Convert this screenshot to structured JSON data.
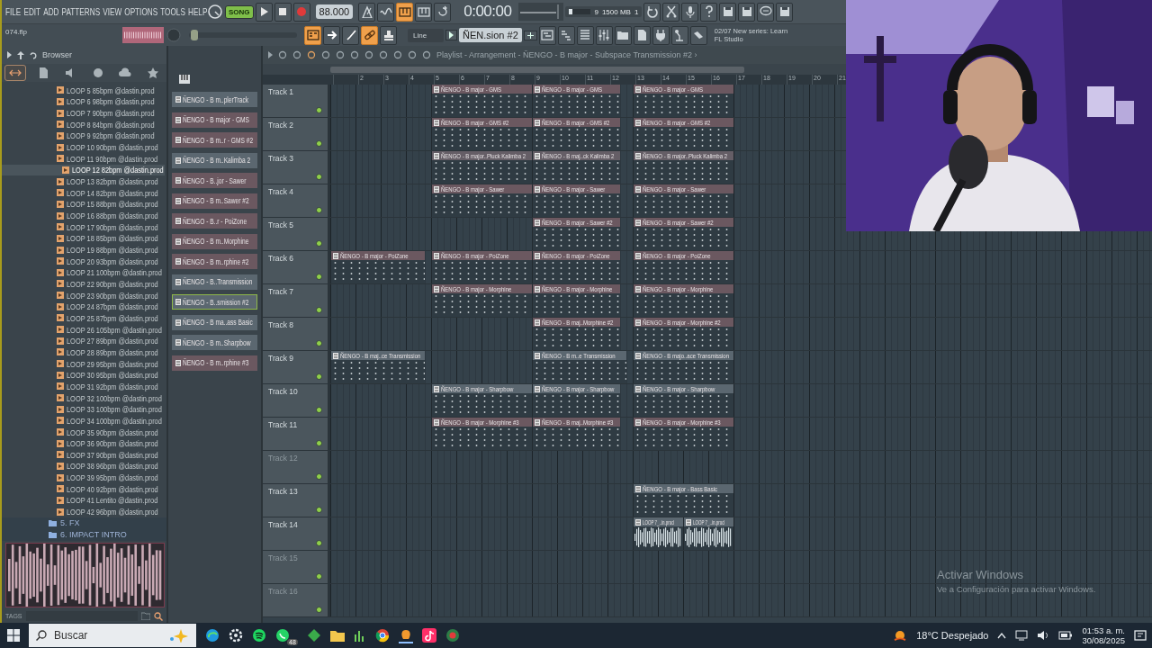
{
  "menu": [
    "FILE",
    "EDIT",
    "ADD",
    "PATTERNS",
    "VIEW",
    "OPTIONS",
    "TOOLS",
    "HELP"
  ],
  "transport": {
    "mode_label": "SONG",
    "song_mode": true,
    "tempo": "88.000",
    "time": "0:00:00"
  },
  "monitor": {
    "voices": "9",
    "memory": "1500 MB",
    "count": "1"
  },
  "top_buttons": [
    {
      "on": false
    },
    {
      "on": false
    },
    {
      "on": true
    },
    {
      "on": false
    },
    {
      "on": false
    }
  ],
  "project": {
    "file": "074.flp"
  },
  "main_slider": {
    "level": 0.02
  },
  "tool_buttons": [
    {
      "on": true
    },
    {
      "on": false
    },
    {
      "on": false
    },
    {
      "on": true
    },
    {
      "on": false
    }
  ],
  "snap": {
    "value": "Line"
  },
  "pattern_selector": {
    "value": "ÑEN.sion #2"
  },
  "hint": {
    "line_1": "02/07  New series: Learn",
    "line_2": "FL Studio"
  },
  "browser": {
    "title": "Browser",
    "filter_tabs": [
      {
        "selected": true
      },
      {
        "selected": false
      },
      {
        "selected": false
      },
      {
        "selected": false
      },
      {
        "selected": false
      },
      {
        "selected": false
      }
    ],
    "items": [
      {
        "label": "LOOP 5 85bpm @dastin.prod",
        "selected": false
      },
      {
        "label": "LOOP 6 98bpm @dastin.prod",
        "selected": false
      },
      {
        "label": "LOOP 7 90bpm @dastin.prod",
        "selected": false
      },
      {
        "label": "LOOP 8 84bpm @dastin.prod",
        "selected": false
      },
      {
        "label": "LOOP 9 92bpm @dastin.prod",
        "selected": false
      },
      {
        "label": "LOOP 10 90bpm @dastin.prod",
        "selected": false
      },
      {
        "label": "LOOP 11 90bpm @dastin.prod",
        "selected": false
      },
      {
        "label": "LOOP 12 82bpm @dastin.prod",
        "selected": true
      },
      {
        "label": "LOOP 13 82bpm @dastin.prod",
        "selected": false
      },
      {
        "label": "LOOP 14 82bpm @dastin.prod",
        "selected": false
      },
      {
        "label": "LOOP 15 88bpm @dastin.prod",
        "selected": false
      },
      {
        "label": "LOOP 16 88bpm @dastin.prod",
        "selected": false
      },
      {
        "label": "LOOP 17 90bpm @dastin.prod",
        "selected": false
      },
      {
        "label": "LOOP 18 85bpm @dastin.prod",
        "selected": false
      },
      {
        "label": "LOOP 19 88bpm @dastin.prod",
        "selected": false
      },
      {
        "label": "LOOP 20 93bpm @dastin.prod",
        "selected": false
      },
      {
        "label": "LOOP 21 100bpm @dastin.prod",
        "selected": false
      },
      {
        "label": "LOOP 22 90bpm @dastin.prod",
        "selected": false
      },
      {
        "label": "LOOP 23 90bpm @dastin.prod",
        "selected": false
      },
      {
        "label": "LOOP 24 87bpm @dastin.prod",
        "selected": false
      },
      {
        "label": "LOOP 25 87bpm @dastin.prod",
        "selected": false
      },
      {
        "label": "LOOP 26 105bpm @dastin.prod",
        "selected": false
      },
      {
        "label": "LOOP 27 89bpm @dastin.prod",
        "selected": false
      },
      {
        "label": "LOOP 28 89bpm @dastin.prod",
        "selected": false
      },
      {
        "label": "LOOP 29 95bpm @dastin.prod",
        "selected": false
      },
      {
        "label": "LOOP 30 95bpm @dastin.prod",
        "selected": false
      },
      {
        "label": "LOOP 31 92bpm @dastin.prod",
        "selected": false
      },
      {
        "label": "LOOP 32 100bpm @dastin.prod",
        "selected": false
      },
      {
        "label": "LOOP 33 100bpm @dastin.prod",
        "selected": false
      },
      {
        "label": "LOOP 34 100bpm @dastin.prod",
        "selected": false
      },
      {
        "label": "LOOP 35 90bpm @dastin.prod",
        "selected": false
      },
      {
        "label": "LOOP 36 90bpm @dastin.prod",
        "selected": false
      },
      {
        "label": "LOOP 37 90bpm @dastin.prod",
        "selected": false
      },
      {
        "label": "LOOP 38 96bpm @dastin.prod",
        "selected": false
      },
      {
        "label": "LOOP 39 95bpm @dastin.prod",
        "selected": false
      },
      {
        "label": "LOOP 40 92bpm @dastin.prod",
        "selected": false
      },
      {
        "label": "LOOP 41 Lentito @dastin.prod",
        "selected": false
      },
      {
        "label": "LOOP 42 96bpm @dastin.prod",
        "selected": false
      }
    ],
    "folders": [
      {
        "label": "5. FX"
      },
      {
        "label": "6. IMPACT INTRO"
      }
    ],
    "tags_label": "TAGS"
  },
  "patterns": [
    {
      "label": "ÑENGO - B m..plerTrack",
      "color": "#5b6770",
      "selected": false
    },
    {
      "label": "ÑENGO - B major - GMS",
      "color": "#6b5860",
      "selected": false
    },
    {
      "label": "ÑENGO - B m..r - GMS #2",
      "color": "#6b5860",
      "selected": false
    },
    {
      "label": "ÑENGO - B m..Kalimba 2",
      "color": "#5b6770",
      "selected": false
    },
    {
      "label": "ÑENGO - B..jor - Sawer",
      "color": "#6b5860",
      "selected": false
    },
    {
      "label": "ÑENGO - B m..Sawer #2",
      "color": "#6b5860",
      "selected": false
    },
    {
      "label": "ÑENGO - B..r - PoiZone",
      "color": "#6b5860",
      "selected": false
    },
    {
      "label": "ÑENGO - B m..Morphine",
      "color": "#6b5860",
      "selected": false
    },
    {
      "label": "ÑENGO - B m..rphine #2",
      "color": "#6b5860",
      "selected": false
    },
    {
      "label": "ÑENGO - B..Transmission",
      "color": "#5b6770",
      "selected": false
    },
    {
      "label": "ÑENGO - B..smission #2",
      "color": "#5b6770",
      "selected": true
    },
    {
      "label": "ÑENGO - B ma..ass Basic",
      "color": "#5b6770",
      "selected": false
    },
    {
      "label": "ÑENGO - B m..Sharpbow",
      "color": "#5b6770",
      "selected": false
    },
    {
      "label": "ÑENGO - B m..rphine #3",
      "color": "#6b5860",
      "selected": false
    }
  ],
  "playlist": {
    "title": "Playlist - Arrangement - ÑENGO - B major - Subspace Transmission #2 ›",
    "ruler": [
      "2",
      "3",
      "4",
      "5",
      "6",
      "7",
      "8",
      "9",
      "10",
      "11",
      "12",
      "13",
      "14",
      "15",
      "16",
      "17",
      "18",
      "19",
      "20",
      "21"
    ],
    "tracks": [
      {
        "name": "Track 1",
        "active": true,
        "clips": [
          {
            "kind": "pattern",
            "label": "ÑENGO - B major - GMS",
            "color": "#6b5860"
          },
          {
            "kind": "pattern",
            "label": "ÑENGO - B major - GMS",
            "color": "#6b5860"
          },
          {
            "kind": "pattern",
            "label": "ÑENGO - B major - GMS",
            "color": "#6b5860"
          }
        ]
      },
      {
        "name": "Track 2",
        "active": true,
        "clips": [
          {
            "kind": "pattern",
            "label": "ÑENGO - B major - GMS #2",
            "color": "#6b5860"
          },
          {
            "kind": "pattern",
            "label": "ÑENGO - B major - GMS #2",
            "color": "#6b5860"
          },
          {
            "kind": "pattern",
            "label": "ÑENGO - B major - GMS #2",
            "color": "#6b5860"
          }
        ]
      },
      {
        "name": "Track 3",
        "active": true,
        "clips": [
          {
            "kind": "pattern",
            "label": "ÑENGO - B major..Pluck Kalimba 2",
            "color": "#655e66"
          },
          {
            "kind": "pattern",
            "label": "ÑENGO - B maj..ck Kalimba 2",
            "color": "#655e66"
          },
          {
            "kind": "pattern",
            "label": "ÑENGO - B major..Pluck Kalimba 2",
            "color": "#655e66"
          }
        ]
      },
      {
        "name": "Track 4",
        "active": true,
        "clips": [
          {
            "kind": "pattern",
            "label": "ÑENGO - B major - Sawer",
            "color": "#6b5860"
          },
          {
            "kind": "pattern",
            "label": "ÑENGO - B major - Sawer",
            "color": "#6b5860"
          },
          {
            "kind": "pattern",
            "label": "ÑENGO - B major - Sawer",
            "color": "#6b5860"
          }
        ]
      },
      {
        "name": "Track 5",
        "active": true,
        "clips": [
          {
            "kind": "pattern",
            "label": "ÑENGO - B major - Sawer #2",
            "color": "#6b5860"
          },
          {
            "kind": "pattern",
            "label": "ÑENGO - B major - Sawer #2",
            "color": "#6b5860"
          }
        ]
      },
      {
        "name": "Track 6",
        "active": true,
        "clips": [
          {
            "kind": "pattern",
            "label": "ÑENGO - B major - PoiZone",
            "color": "#6b5860"
          },
          {
            "kind": "pattern",
            "label": "ÑENGO - B major - PoiZone",
            "color": "#6b5860"
          },
          {
            "kind": "pattern",
            "label": "ÑENGO - B major - PoiZone",
            "color": "#6b5860"
          },
          {
            "kind": "pattern",
            "label": "ÑENGO - B major - PoiZone",
            "color": "#6b5860"
          }
        ]
      },
      {
        "name": "Track 7",
        "active": true,
        "clips": [
          {
            "kind": "pattern",
            "label": "ÑENGO - B major - Morphine",
            "color": "#6b5860"
          },
          {
            "kind": "pattern",
            "label": "ÑENGO - B major - Morphine",
            "color": "#6b5860"
          },
          {
            "kind": "pattern",
            "label": "ÑENGO - B major - Morphine",
            "color": "#6b5860"
          }
        ]
      },
      {
        "name": "Track 8",
        "active": true,
        "clips": [
          {
            "kind": "pattern",
            "label": "ÑENGO - B maj..Morphine #2",
            "color": "#6b5860"
          },
          {
            "kind": "pattern",
            "label": "ÑENGO - B major - Morphine #2",
            "color": "#6b5860"
          }
        ]
      },
      {
        "name": "Track 9",
        "active": true,
        "clips": [
          {
            "kind": "pattern",
            "label": "ÑENGO - B maj..ce Transmission",
            "color": "#5b6770"
          },
          {
            "kind": "pattern",
            "label": "ÑENGO - B m..e Transmission",
            "color": "#5b6770"
          },
          {
            "kind": "pattern",
            "label": "ÑENGO - B majo..ace Transmission",
            "color": "#5b6770"
          }
        ]
      },
      {
        "name": "Track 10",
        "active": true,
        "clips": [
          {
            "kind": "pattern",
            "label": "ÑENGO - B major - Sharpbow",
            "color": "#5b6770"
          },
          {
            "kind": "pattern",
            "label": "ÑENGO - B major - Sharpbow",
            "color": "#5b6770"
          },
          {
            "kind": "pattern",
            "label": "ÑENGO - B major - Sharpbow",
            "color": "#5b6770"
          }
        ]
      },
      {
        "name": "Track 11",
        "active": true,
        "clips": [
          {
            "kind": "pattern",
            "label": "ÑENGO - B major - Morphine #3",
            "color": "#6b5860"
          },
          {
            "kind": "pattern",
            "label": "ÑENGO - B maj..Morphine #3",
            "color": "#6b5860"
          },
          {
            "kind": "pattern",
            "label": "ÑENGO - B major - Morphine #3",
            "color": "#6b5860"
          }
        ]
      },
      {
        "name": "Track 12",
        "active": false
      },
      {
        "name": "Track 13",
        "active": true,
        "clips": [
          {
            "kind": "pattern",
            "label": "ÑENGO - B major - Bass Basic",
            "color": "#5b6770"
          }
        ]
      },
      {
        "name": "Track 14",
        "active": true,
        "clips": [
          {
            "kind": "audio",
            "label": "LOOP 7_..in.prod",
            "color": "#5b6770"
          },
          {
            "kind": "audio",
            "label": "LOOP 7_..in.prod",
            "color": "#5b6770"
          }
        ]
      },
      {
        "name": "Track 15",
        "active": false
      },
      {
        "name": "Track 16",
        "active": false
      }
    ]
  },
  "activation_notice": {
    "title": "Activar Windows",
    "text": "Ve a Configuración para activar Windows."
  },
  "taskbar": {
    "search_placeholder": "Buscar",
    "chat_badge": "48",
    "weather": "18°C Despejado",
    "time": "01:53 a. m.",
    "date": "30/08/2025"
  }
}
